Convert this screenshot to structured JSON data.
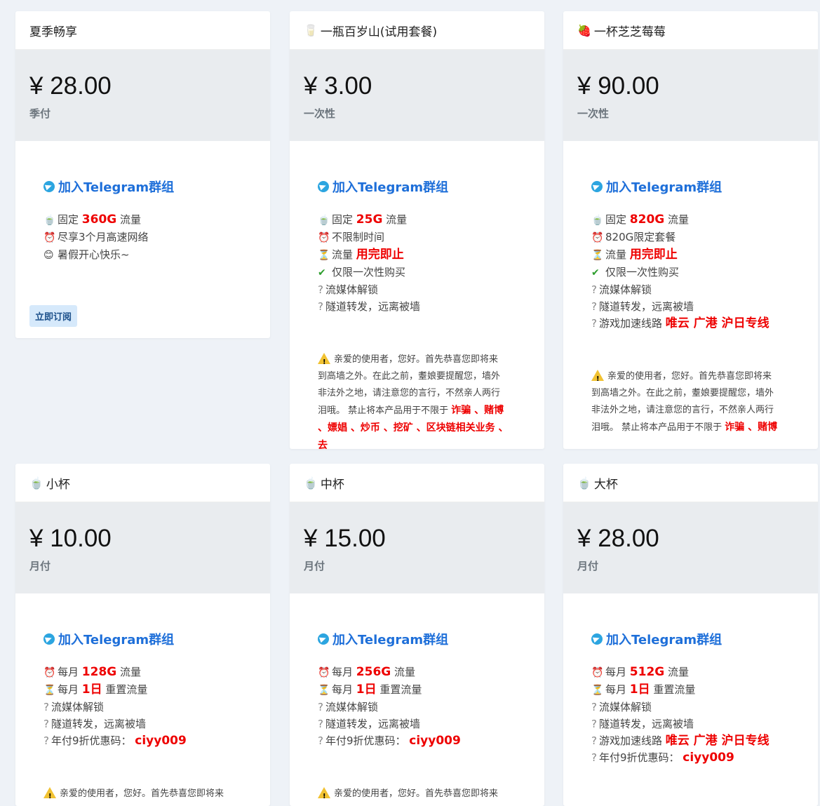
{
  "tg_link_label": "加入Telegram群组",
  "subscribe_label": "立即订阅",
  "cards": [
    {
      "title": "夏季畅享",
      "icon": "",
      "price": "¥ 28.00",
      "period": "季付",
      "features": [
        {
          "icon": "🍵",
          "pre": "固定 ",
          "hl": "360G",
          "post": " 流量"
        },
        {
          "icon": "⏰",
          "pre": "尽享3个月高速网络",
          "hl": "",
          "post": ""
        },
        {
          "icon": "😊",
          "pre": "暑假开心快乐~",
          "hl": "",
          "post": ""
        }
      ]
    },
    {
      "title": "一瓶百岁山(试用套餐)",
      "icon": "🥛",
      "price": "¥ 3.00",
      "period": "一次性",
      "features": [
        {
          "icon": "🍵",
          "pre": "固定 ",
          "hl": "25G",
          "post": " 流量"
        },
        {
          "icon": "⏰",
          "pre": "不限制时间",
          "hl": "",
          "post": ""
        },
        {
          "icon": "⏳",
          "pre": "流量 ",
          "hl": "用完即止",
          "post": ""
        },
        {
          "icon": "✔",
          "pre": "仅限一次性购买",
          "hl": "",
          "post": ""
        },
        {
          "icon": "?",
          "pre": "流媒体解锁",
          "hl": "",
          "post": ""
        },
        {
          "icon": "?",
          "pre": "隧道转发，远离被墙",
          "hl": "",
          "post": ""
        }
      ],
      "notice": {
        "lines": [
          "亲爱的使用者，您好。首先恭喜您即将来",
          "到高墙之外。在此之前，耋娘要提醒您，墙外",
          "非法外之地，请注意您的言行，不然亲人两行",
          "泪哦。 禁止将本产品用于不限于 "
        ],
        "hl1": "诈骗 、赌博",
        "hl2": "、嫖娼 、炒币 、挖矿 、区块链相关业务 、去"
      }
    },
    {
      "title": "一杯芝芝莓莓",
      "icon": "🍓",
      "price": "¥ 90.00",
      "period": "一次性",
      "features": [
        {
          "icon": "🍵",
          "pre": "固定 ",
          "hl": "820G",
          "post": " 流量"
        },
        {
          "icon": "⏰",
          "pre": "820G限定套餐",
          "hl": "",
          "post": ""
        },
        {
          "icon": "⏳",
          "pre": "流量 ",
          "hl": "用完即止",
          "post": ""
        },
        {
          "icon": "✔",
          "pre": "仅限一次性购买",
          "hl": "",
          "post": ""
        },
        {
          "icon": "?",
          "pre": "流媒体解锁",
          "hl": "",
          "post": ""
        },
        {
          "icon": "?",
          "pre": "隧道转发，远离被墙",
          "hl": "",
          "post": ""
        },
        {
          "icon": "?",
          "pre": "游戏加速线路 ",
          "hl": "唯云 广港 沪日专线",
          "post": ""
        }
      ],
      "notice": {
        "lines": [
          "亲爱的使用者，您好。首先恭喜您即将来",
          "到高墙之外。在此之前，耋娘要提醒您，墙外",
          "非法外之地，请注意您的言行，不然亲人两行",
          "泪哦。 禁止将本产品用于不限于 "
        ],
        "hl1": "诈骗 、赌博",
        "hl2": ""
      }
    },
    {
      "title": "小杯",
      "icon": "🍵",
      "price": "¥ 10.00",
      "period": "月付",
      "features": [
        {
          "icon": "⏰",
          "pre": "每月 ",
          "hl": "128G",
          "post": " 流量"
        },
        {
          "icon": "⏳",
          "pre": "每月 ",
          "hl": "1日",
          "post": " 重置流量"
        },
        {
          "icon": "?",
          "pre": "流媒体解锁",
          "hl": "",
          "post": ""
        },
        {
          "icon": "?",
          "pre": "隧道转发，远离被墙",
          "hl": "",
          "post": ""
        },
        {
          "icon": "?",
          "pre": "年付9折优惠码： ",
          "hl": "ciyy009",
          "post": ""
        }
      ],
      "notice": {
        "lines": [
          "亲爱的使用者，您好。首先恭喜您即将来"
        ],
        "hl1": "",
        "hl2": ""
      }
    },
    {
      "title": "中杯",
      "icon": "🍵",
      "price": "¥ 15.00",
      "period": "月付",
      "features": [
        {
          "icon": "⏰",
          "pre": "每月 ",
          "hl": "256G",
          "post": " 流量"
        },
        {
          "icon": "⏳",
          "pre": "每月 ",
          "hl": "1日",
          "post": " 重置流量"
        },
        {
          "icon": "?",
          "pre": "流媒体解锁",
          "hl": "",
          "post": ""
        },
        {
          "icon": "?",
          "pre": "隧道转发，远离被墙",
          "hl": "",
          "post": ""
        },
        {
          "icon": "?",
          "pre": "年付9折优惠码： ",
          "hl": "ciyy009",
          "post": ""
        }
      ],
      "notice": {
        "lines": [
          "亲爱的使用者，您好。首先恭喜您即将来"
        ],
        "hl1": "",
        "hl2": ""
      }
    },
    {
      "title": "大杯",
      "icon": "🍵",
      "price": "¥ 28.00",
      "period": "月付",
      "features": [
        {
          "icon": "⏰",
          "pre": "每月 ",
          "hl": "512G",
          "post": " 流量"
        },
        {
          "icon": "⏳",
          "pre": "每月 ",
          "hl": "1日",
          "post": " 重置流量"
        },
        {
          "icon": "?",
          "pre": "流媒体解锁",
          "hl": "",
          "post": ""
        },
        {
          "icon": "?",
          "pre": "隧道转发，远离被墙",
          "hl": "",
          "post": ""
        },
        {
          "icon": "?",
          "pre": "游戏加速线路 ",
          "hl": "唯云 广港 沪日专线",
          "post": ""
        },
        {
          "icon": "?",
          "pre": "年付9折优惠码： ",
          "hl": "ciyy009",
          "post": ""
        }
      ]
    }
  ]
}
